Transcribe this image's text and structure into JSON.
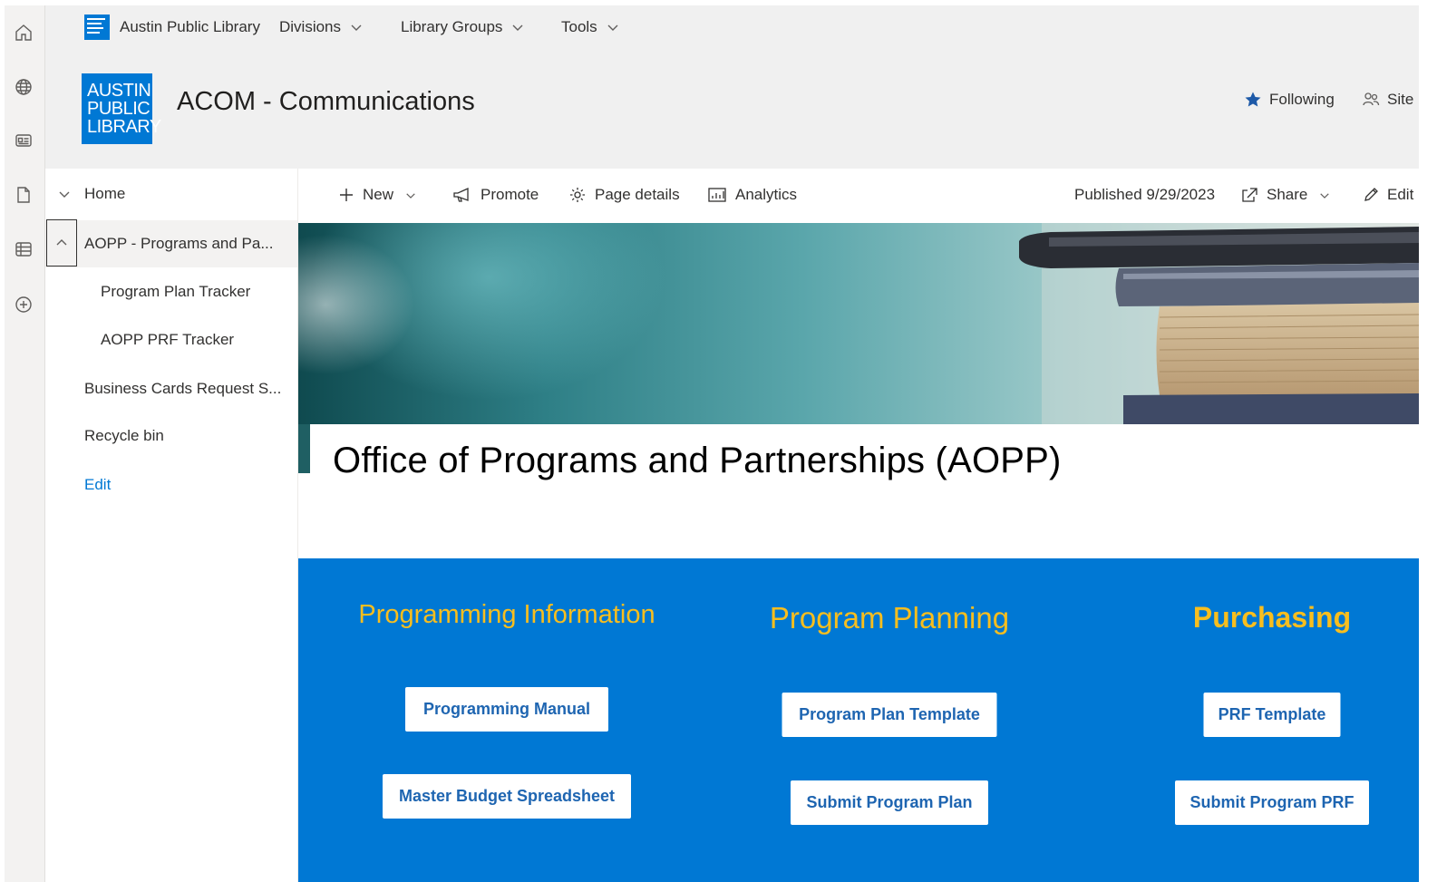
{
  "hub": {
    "site_name": "Austin Public Library",
    "menus": [
      "Divisions",
      "Library Groups",
      "Tools"
    ]
  },
  "header": {
    "logo_lines": [
      "AUSTIN",
      "PUBLIC",
      "LIBRARY"
    ],
    "title": "ACOM - Communications",
    "following_label": "Following",
    "site_label": "Site"
  },
  "rail": {
    "icons": [
      "home-icon",
      "globe-icon",
      "news-icon",
      "document-icon",
      "list-icon",
      "add-circle-icon"
    ]
  },
  "leftnav": {
    "items": [
      {
        "label": "Home",
        "level": 0,
        "toggle": "chevron-down-icon"
      },
      {
        "label": "AOPP - Programs and Pa...",
        "level": 0,
        "toggle": "chevron-up-icon",
        "selected": true
      },
      {
        "label": "Program Plan Tracker",
        "level": 1
      },
      {
        "label": "AOPP PRF Tracker",
        "level": 1
      },
      {
        "label": "Business Cards Request S...",
        "level": 0
      },
      {
        "label": "Recycle bin",
        "level": 0
      }
    ],
    "edit_label": "Edit"
  },
  "commandbar": {
    "new_label": "New",
    "promote_label": "Promote",
    "page_details_label": "Page details",
    "analytics_label": "Analytics",
    "published_text": "Published 9/29/2023",
    "share_label": "Share",
    "edit_label": "Edit"
  },
  "page": {
    "title": "Office of Programs and Partnerships (AOPP)"
  },
  "sections": [
    {
      "heading": "Programming Information",
      "buttons": [
        "Programming Manual",
        "Master Budget Spreadsheet"
      ]
    },
    {
      "heading": "Program Planning",
      "buttons": [
        "Program Plan Template",
        "Submit Program Plan"
      ]
    },
    {
      "heading": "Purchasing",
      "buttons": [
        "PRF Template",
        "Submit Program PRF"
      ]
    }
  ],
  "colors": {
    "brand_blue": "#0078d4",
    "heading_gold": "#f8be1e",
    "button_text_blue": "#1e65b1"
  }
}
